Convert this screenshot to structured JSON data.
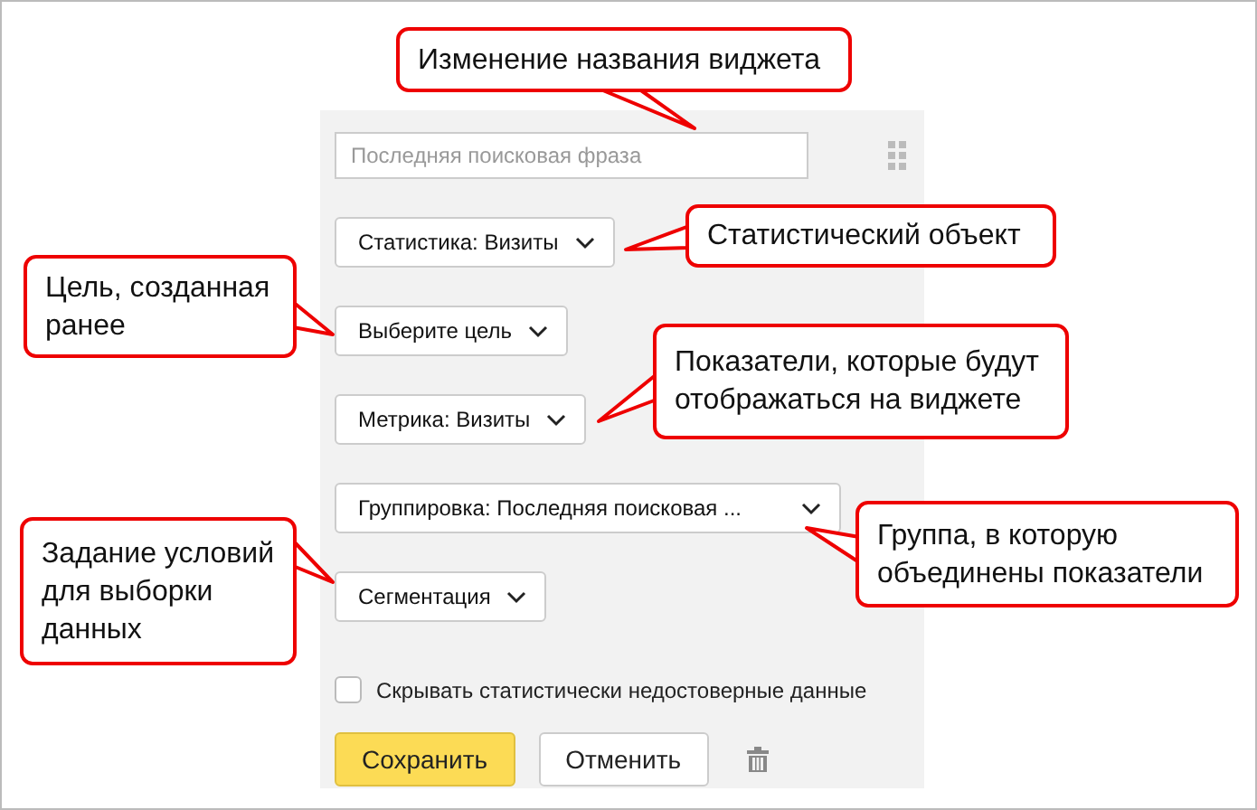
{
  "widget": {
    "name_field": {
      "placeholder": "Последняя поисковая фраза"
    },
    "dropdowns": [
      {
        "label": "Статистика: Визиты"
      },
      {
        "label": "Выберите цель"
      },
      {
        "label": "Метрика: Визиты"
      },
      {
        "label": "Группировка: Последняя поисковая ..."
      },
      {
        "label": "Сегментация"
      }
    ],
    "hide_unreliable": {
      "label": "Скрывать статистически недостоверные данные",
      "checked": false
    },
    "buttons": [
      {
        "label": "Сохранить",
        "kind": "primary"
      },
      {
        "label": "Отменить",
        "kind": "secondary"
      }
    ]
  },
  "callouts": [
    {
      "text": "Изменение названия виджета"
    },
    {
      "text": "Статистический объект"
    },
    {
      "text": "Цель, созданная ранее"
    },
    {
      "text": "Показатели, которые будут отображаться на виджете"
    },
    {
      "text": "Группа, в которую объединены показатели"
    },
    {
      "text": "Задание условий для выборки данных"
    }
  ]
}
